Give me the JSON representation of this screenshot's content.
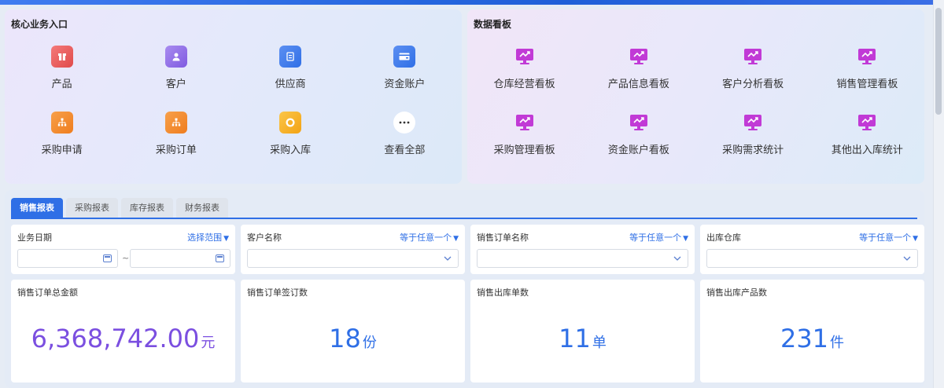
{
  "core": {
    "title": "核心业务入口",
    "items": [
      {
        "label": "产品",
        "icon": "product-icon"
      },
      {
        "label": "客户",
        "icon": "customer-icon"
      },
      {
        "label": "供应商",
        "icon": "supplier-icon"
      },
      {
        "label": "资金账户",
        "icon": "wallet-icon"
      },
      {
        "label": "采购申请",
        "icon": "org-chart-icon"
      },
      {
        "label": "采购订单",
        "icon": "org-chart-icon"
      },
      {
        "label": "采购入库",
        "icon": "warehouse-in-icon"
      },
      {
        "label": "查看全部",
        "icon": "more-icon"
      }
    ]
  },
  "board": {
    "title": "数据看板",
    "items": [
      {
        "label": "仓库经营看板",
        "icon": "monitor-chart-icon"
      },
      {
        "label": "产品信息看板",
        "icon": "monitor-chart-icon"
      },
      {
        "label": "客户分析看板",
        "icon": "monitor-chart-icon"
      },
      {
        "label": "销售管理看板",
        "icon": "monitor-chart-icon"
      },
      {
        "label": "采购管理看板",
        "icon": "monitor-chart-icon"
      },
      {
        "label": "资金账户看板",
        "icon": "monitor-chart-icon"
      },
      {
        "label": "采购需求统计",
        "icon": "monitor-chart-icon"
      },
      {
        "label": "其他出入库统计",
        "icon": "monitor-chart-icon"
      }
    ]
  },
  "report": {
    "tabs": [
      "销售报表",
      "采购报表",
      "库存报表",
      "财务报表"
    ],
    "active_tab": "销售报表",
    "filters": [
      {
        "label": "业务日期",
        "mode": "选择范围"
      },
      {
        "label": "客户名称",
        "mode": "等于任意一个"
      },
      {
        "label": "销售订单名称",
        "mode": "等于任意一个"
      },
      {
        "label": "出库仓库",
        "mode": "等于任意一个"
      }
    ],
    "date_separator": "~",
    "stats": [
      {
        "label": "销售订单总金额",
        "value": "6,368,742.00",
        "unit": "元"
      },
      {
        "label": "销售订单签订数",
        "value": "18",
        "unit": "份"
      },
      {
        "label": "销售出库单数",
        "value": "11",
        "unit": "单"
      },
      {
        "label": "销售出库产品数",
        "value": "231",
        "unit": "件"
      }
    ]
  },
  "colors": {
    "accent": "#2f6fe6",
    "amount_purple": "#7b4fe0",
    "board_icon": "#c13ad6"
  }
}
